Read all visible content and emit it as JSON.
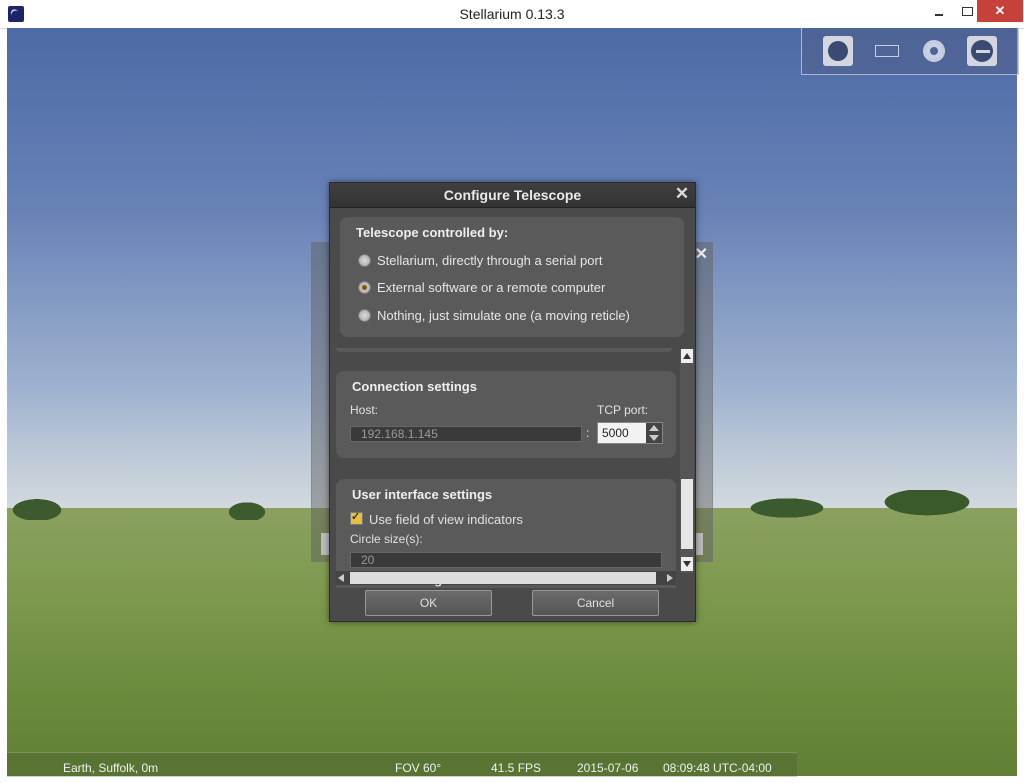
{
  "window": {
    "title": "Stellarium 0.13.3"
  },
  "toolbar_icons": [
    "planet-icon",
    "rectangle-icon",
    "target-icon",
    "telescope-icon"
  ],
  "dialog": {
    "title": "Configure Telescope",
    "control_group": {
      "heading": "Telescope controlled by:",
      "options": [
        {
          "label": "Stellarium, directly through a serial port",
          "selected": false
        },
        {
          "label": "External software or a remote computer",
          "selected": true
        },
        {
          "label": "Nothing, just simulate one (a moving reticle)",
          "selected": false
        }
      ]
    },
    "connection": {
      "heading": "Connection settings",
      "host_label": "Host:",
      "host_value": "192.168.1.145",
      "separator": ":",
      "port_label": "TCP port:",
      "port_value": "5000"
    },
    "ui_settings": {
      "heading": "User interface settings",
      "fov_checkbox_label": "Use field of view indicators",
      "fov_checked": true,
      "circle_label": "Circle size(s):",
      "circle_value": "20"
    },
    "partial_next_section": "Device settings",
    "ok_label": "OK",
    "cancel_label": "Cancel"
  },
  "status": {
    "location": "Earth, Suffolk, 0m",
    "fov": "FOV 60°",
    "fps": "41.5 FPS",
    "date": "2015-07-06",
    "time": "08:09:48 UTC-04:00"
  }
}
